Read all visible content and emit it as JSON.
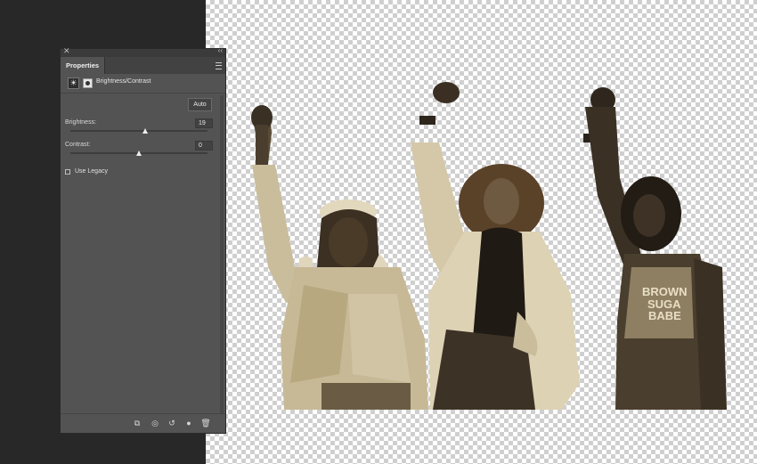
{
  "panel": {
    "tab_label": "Properties",
    "adjustment_title": "Brightness/Contrast",
    "auto_label": "Auto",
    "brightness": {
      "label": "Brightness:",
      "value": "19",
      "level": 0.55
    },
    "contrast": {
      "label": "Contrast:",
      "value": "0",
      "level": 0.5
    },
    "use_legacy": {
      "label": "Use Legacy",
      "checked": false
    }
  },
  "footer_icons": [
    "clip-to-layer-icon",
    "view-previous-icon",
    "reset-icon",
    "visibility-icon",
    "trash-icon"
  ],
  "canvas": {
    "image_description": "Sepia-toned cutout of three young women raising fists on a transparent layer",
    "shirt_text": "BROWN SUGA BABE"
  },
  "colors": {
    "workspace": "#282828",
    "panel": "#535353",
    "sepia_light": "#d8ceb0",
    "sepia_dark": "#2a241a"
  }
}
